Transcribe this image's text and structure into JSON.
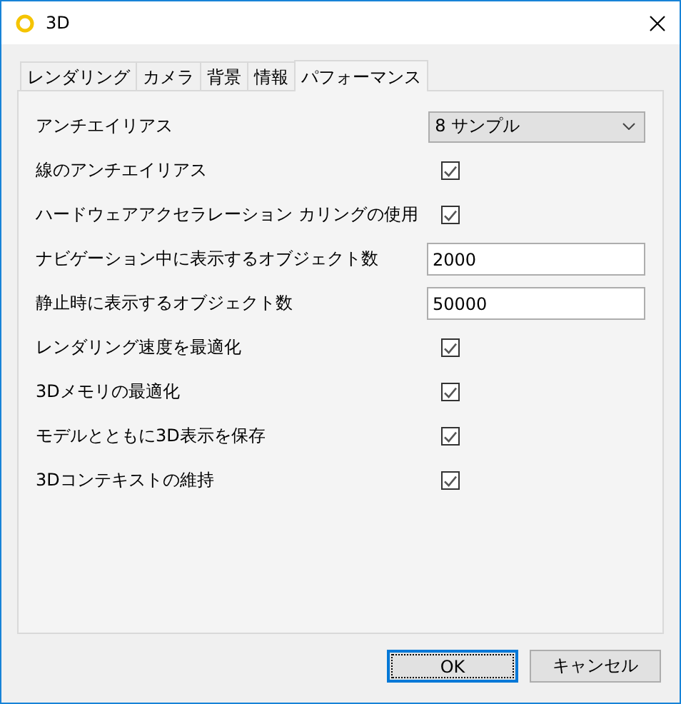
{
  "window": {
    "title": "3D"
  },
  "tabs": [
    {
      "label": "レンダリング",
      "selected": false
    },
    {
      "label": "カメラ",
      "selected": false
    },
    {
      "label": "背景",
      "selected": false
    },
    {
      "label": "情報",
      "selected": false
    },
    {
      "label": "パフォーマンス",
      "selected": true
    }
  ],
  "settings": [
    {
      "kind": "dropdown",
      "label": "アンチエイリアス",
      "value": "8 サンプル"
    },
    {
      "kind": "checkbox",
      "label": "線のアンチエイリアス",
      "checked": true
    },
    {
      "kind": "checkbox",
      "label": "ハードウェアアクセラレーション カリングの使用",
      "checked": true
    },
    {
      "kind": "number",
      "label": "ナビゲーション中に表示するオブジェクト数",
      "value": "2000"
    },
    {
      "kind": "number",
      "label": "静止時に表示するオブジェクト数",
      "value": "50000"
    },
    {
      "kind": "checkbox",
      "label": "レンダリング速度を最適化",
      "checked": true
    },
    {
      "kind": "checkbox",
      "label": "3Dメモリの最適化",
      "checked": true
    },
    {
      "kind": "checkbox",
      "label": "モデルとともに3D表示を保存",
      "checked": true
    },
    {
      "kind": "checkbox",
      "label": "3Dコンテキストの維持",
      "checked": true
    }
  ],
  "buttons": [
    {
      "label": "OK",
      "default": true
    },
    {
      "label": "キャンセル",
      "default": false
    }
  ]
}
